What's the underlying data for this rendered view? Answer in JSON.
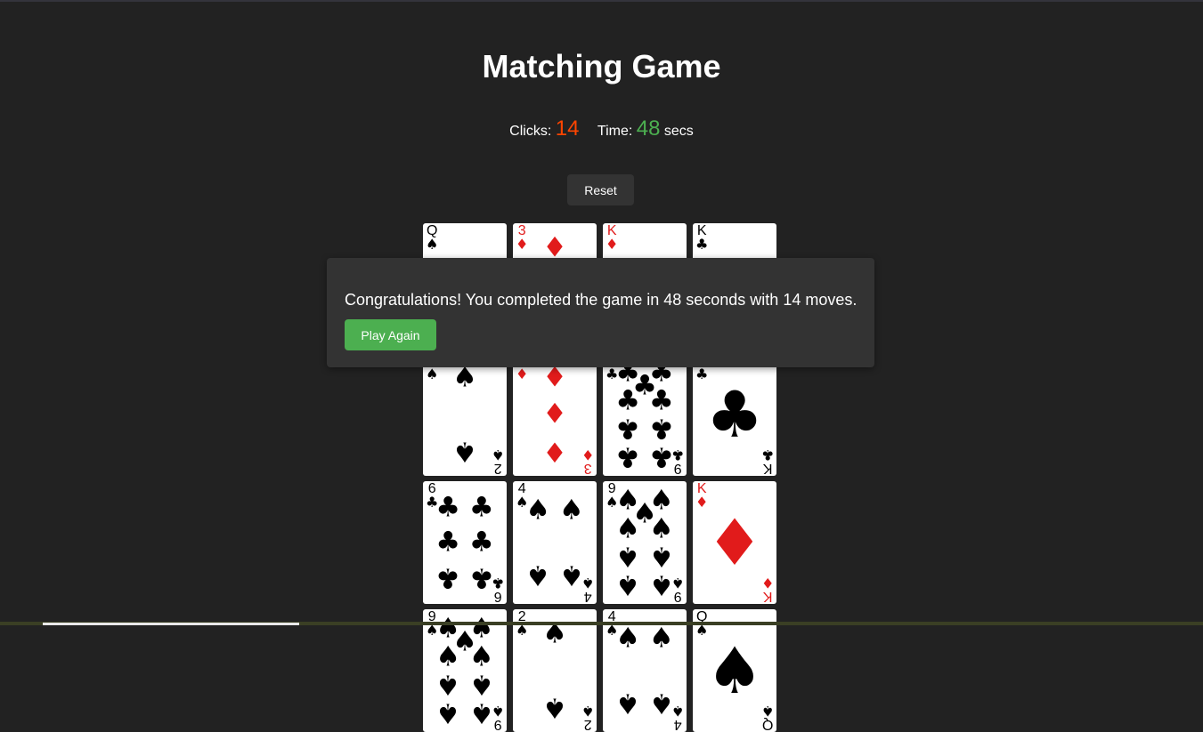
{
  "title": "Matching Game",
  "stats": {
    "clicks_label": "Clicks:",
    "clicks_value": "14",
    "time_label": "Time:",
    "time_value": "48",
    "time_unit": "secs"
  },
  "reset_label": "Reset",
  "modal": {
    "message": "Congratulations! You completed the game in 48 seconds with 14 moves.",
    "button_label": "Play Again"
  },
  "colors": {
    "background": "#222222",
    "panel": "#333333",
    "clicks_accent": "#ff4500",
    "time_accent": "#4caf50",
    "play_button": "#4caf50"
  },
  "cards": [
    {
      "rank": "Q",
      "suit": "spades"
    },
    {
      "rank": "3",
      "suit": "diamonds"
    },
    {
      "rank": "K",
      "suit": "diamonds"
    },
    {
      "rank": "K",
      "suit": "clubs"
    },
    {
      "rank": "2",
      "suit": "spades"
    },
    {
      "rank": "3",
      "suit": "diamonds"
    },
    {
      "rank": "9",
      "suit": "clubs"
    },
    {
      "rank": "K",
      "suit": "clubs"
    },
    {
      "rank": "6",
      "suit": "clubs"
    },
    {
      "rank": "4",
      "suit": "spades"
    },
    {
      "rank": "9",
      "suit": "spades"
    },
    {
      "rank": "K",
      "suit": "diamonds"
    },
    {
      "rank": "9",
      "suit": "spades"
    },
    {
      "rank": "2",
      "suit": "spades"
    },
    {
      "rank": "4",
      "suit": "spades"
    },
    {
      "rank": "Q",
      "suit": "spades"
    }
  ]
}
